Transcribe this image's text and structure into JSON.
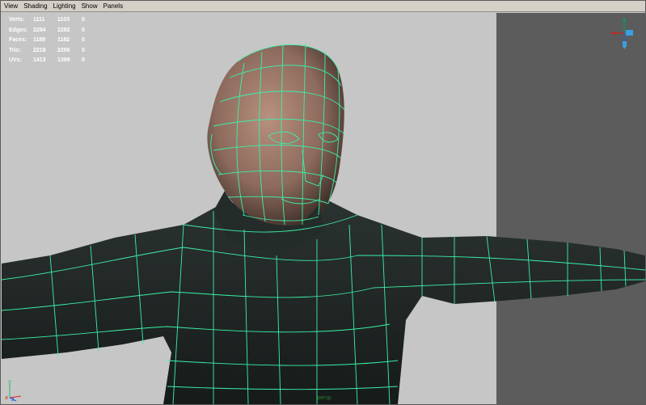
{
  "menu": [
    "View",
    "Shading",
    "Lighting",
    "Show",
    "Panels"
  ],
  "hud": {
    "rows": [
      {
        "label": "Verts:",
        "a": "1111",
        "b": "1103",
        "c": "0"
      },
      {
        "label": "Edges:",
        "a": "2294",
        "b": "2282",
        "c": "0"
      },
      {
        "label": "Faces:",
        "a": "1188",
        "b": "1182",
        "c": "0"
      },
      {
        "label": "Tris:",
        "a": "2218",
        "b": "2206",
        "c": "0"
      },
      {
        "label": "UVs:",
        "a": "1413",
        "b": "1399",
        "c": "0"
      }
    ]
  },
  "axis": {
    "y": "y",
    "x": "x",
    "z": "z"
  },
  "camera_label": "persp",
  "colors": {
    "wireframe": "#3cf0a8",
    "background": "#c6c6c6",
    "wall": "#5c5c5c",
    "mesh_dark": "#1f2624",
    "skin": "#a88070"
  },
  "icons": [
    "view-cube-icon",
    "axis-triad-icon"
  ]
}
